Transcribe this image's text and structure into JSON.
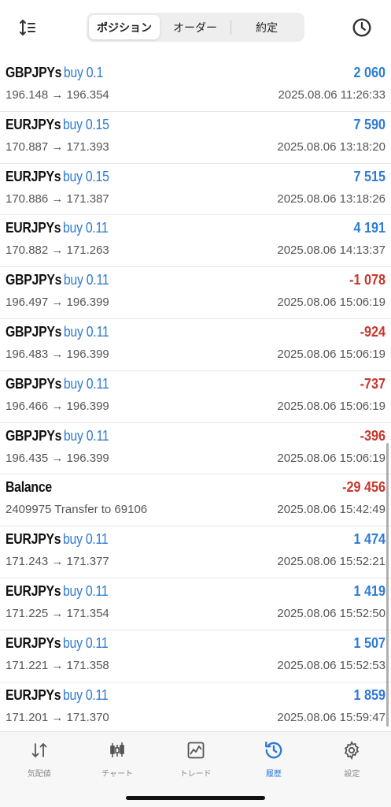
{
  "header": {
    "segments": [
      {
        "label": "ポジション",
        "active": false
      },
      {
        "label": "オーダー",
        "active": false
      },
      {
        "label": "約定",
        "active": false
      }
    ],
    "active_segment_label": "ポジション"
  },
  "deals": [
    {
      "symbol": "GBPJPYs",
      "side": "buy 0.1",
      "prices": "196.148 → 196.354",
      "profit": "2 060",
      "sign": "pos",
      "time": "2025.08.06 11:26:33"
    },
    {
      "symbol": "EURJPYs",
      "side": "buy 0.15",
      "prices": "170.887 → 171.393",
      "profit": "7 590",
      "sign": "pos",
      "time": "2025.08.06 13:18:20"
    },
    {
      "symbol": "EURJPYs",
      "side": "buy 0.15",
      "prices": "170.886 → 171.387",
      "profit": "7 515",
      "sign": "pos",
      "time": "2025.08.06 13:18:26"
    },
    {
      "symbol": "EURJPYs",
      "side": "buy 0.11",
      "prices": "170.882 → 171.263",
      "profit": "4 191",
      "sign": "pos",
      "time": "2025.08.06 14:13:37"
    },
    {
      "symbol": "GBPJPYs",
      "side": "buy 0.11",
      "prices": "196.497 → 196.399",
      "profit": "-1 078",
      "sign": "neg",
      "time": "2025.08.06 15:06:19"
    },
    {
      "symbol": "GBPJPYs",
      "side": "buy 0.11",
      "prices": "196.483 → 196.399",
      "profit": "-924",
      "sign": "neg",
      "time": "2025.08.06 15:06:19"
    },
    {
      "symbol": "GBPJPYs",
      "side": "buy 0.11",
      "prices": "196.466 → 196.399",
      "profit": "-737",
      "sign": "neg",
      "time": "2025.08.06 15:06:19"
    },
    {
      "symbol": "GBPJPYs",
      "side": "buy 0.11",
      "prices": "196.435 → 196.399",
      "profit": "-396",
      "sign": "neg",
      "time": "2025.08.06 15:06:19"
    },
    {
      "symbol": "Balance",
      "side": "",
      "prices": "2409975 Transfer to 69106",
      "profit": "-29 456",
      "sign": "neg",
      "time": "2025.08.06 15:42:49"
    },
    {
      "symbol": "EURJPYs",
      "side": "buy 0.11",
      "prices": "171.243 → 171.377",
      "profit": "1 474",
      "sign": "pos",
      "time": "2025.08.06 15:52:21"
    },
    {
      "symbol": "EURJPYs",
      "side": "buy 0.11",
      "prices": "171.225 → 171.354",
      "profit": "1 419",
      "sign": "pos",
      "time": "2025.08.06 15:52:50"
    },
    {
      "symbol": "EURJPYs",
      "side": "buy 0.11",
      "prices": "171.221 → 171.358",
      "profit": "1 507",
      "sign": "pos",
      "time": "2025.08.06 15:52:53"
    },
    {
      "symbol": "EURJPYs",
      "side": "buy 0.11",
      "prices": "171.201 → 171.370",
      "profit": "1 859",
      "sign": "pos",
      "time": "2025.08.06 15:59:47"
    }
  ],
  "tabbar": {
    "items": [
      {
        "label": "気配値",
        "icon": "quotes-icon"
      },
      {
        "label": "チャート",
        "icon": "chart-icon"
      },
      {
        "label": "トレード",
        "icon": "trade-icon"
      },
      {
        "label": "履歴",
        "icon": "history-icon",
        "active": true
      },
      {
        "label": "設定",
        "icon": "settings-icon"
      }
    ]
  },
  "colors": {
    "positive": "#2e7bd6",
    "negative": "#c8372d",
    "accent": "#2e7bd6"
  }
}
